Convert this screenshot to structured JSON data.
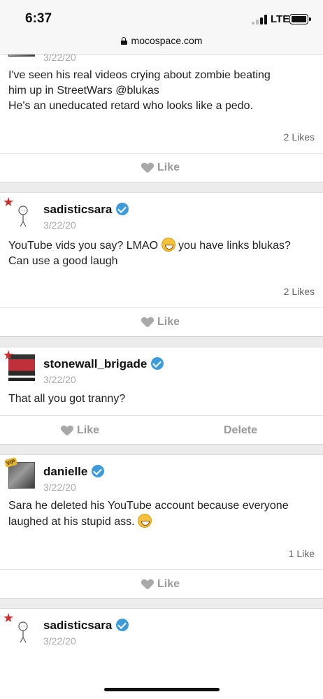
{
  "status_bar": {
    "time": "6:37",
    "network": "LTE"
  },
  "browser": {
    "url": "mocospace.com"
  },
  "posts": [
    {
      "date": "3/22/20",
      "lines": [
        "I've seen his real videos crying about zombie beating",
        "him up in StreetWars @blukas",
        "He's an uneducated retard who looks like a pedo."
      ],
      "likes_count": "2 Likes",
      "like_label": "Like"
    },
    {
      "username": "sadisticsara",
      "date": "3/22/20",
      "lines": [
        "YouTube vids you say? LMAO",
        "you have links blukas?",
        "Can use a good laugh"
      ],
      "likes_count": "2 Likes",
      "like_label": "Like"
    },
    {
      "username": "stonewall_brigade",
      "date": "3/22/20",
      "lines": [
        "That all you got tranny?"
      ],
      "like_label": "Like",
      "delete_label": "Delete"
    },
    {
      "username": "danielle",
      "date": "3/22/20",
      "lines": [
        "Sara he deleted his YouTube account because everyone",
        "laughed at his stupid ass."
      ],
      "likes_count": "1 Like",
      "like_label": "Like"
    },
    {
      "username": "sadisticsara",
      "date": "3/22/20"
    }
  ]
}
